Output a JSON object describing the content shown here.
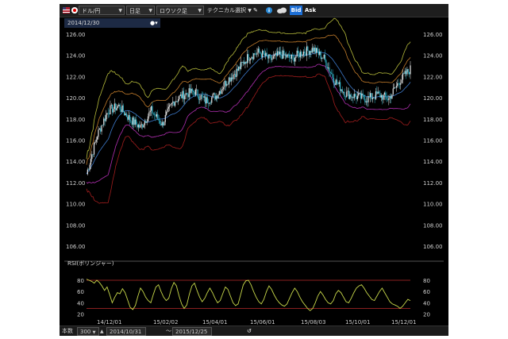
{
  "toolbar": {
    "pair": "ドル/円",
    "period": "日足",
    "chart_kind": "ロウソク足",
    "technical": "テクニカル選択",
    "bid_label": "Bid",
    "ask_label": "Ask"
  },
  "header": {
    "date": "2014/12/30"
  },
  "rsi": {
    "label": "RSI(ボリンジャー)"
  },
  "bottombar": {
    "count_label": "本数",
    "count_value": "300",
    "start_date": "2014/10/31",
    "range_sep": "～",
    "end_date": "2015/12/25"
  },
  "colors": {
    "background": "#000000",
    "rsi_line": "#c8d84a",
    "rsi_band": "#8a1f1f",
    "bid_button": "#1d6fd6"
  },
  "chart_data": [
    {
      "type": "candlestick",
      "yticks": [
        "126.00",
        "124.00",
        "122.00",
        "120.00",
        "118.00",
        "116.00",
        "114.00",
        "112.00",
        "110.00",
        "108.00",
        "106.00"
      ],
      "ylim": [
        106,
        126
      ],
      "xticks": [
        "14/12/01",
        "15/02/02",
        "15/04/01",
        "15/06/01",
        "15/08/03",
        "15/10/01",
        "15/12/01"
      ],
      "price_path": [
        [
          0,
          112.8
        ],
        [
          10,
          116.5
        ],
        [
          20,
          118.8
        ],
        [
          30,
          119.2
        ],
        [
          40,
          118.0
        ],
        [
          50,
          117.2
        ],
        [
          60,
          118.8
        ],
        [
          70,
          117.5
        ],
        [
          80,
          119.6
        ],
        [
          90,
          120.3
        ],
        [
          100,
          120.6
        ],
        [
          110,
          119.7
        ],
        [
          120,
          120.2
        ],
        [
          130,
          121.6
        ],
        [
          140,
          122.6
        ],
        [
          150,
          123.9
        ],
        [
          160,
          124.3
        ],
        [
          170,
          123.6
        ],
        [
          180,
          124.1
        ],
        [
          190,
          123.7
        ],
        [
          200,
          124.3
        ],
        [
          210,
          124.6
        ],
        [
          220,
          123.7
        ],
        [
          230,
          121.6
        ],
        [
          240,
          120.4
        ],
        [
          250,
          120.1
        ],
        [
          260,
          119.9
        ],
        [
          270,
          120.3
        ],
        [
          280,
          119.9
        ],
        [
          290,
          121.6
        ],
        [
          300,
          122.7
        ]
      ]
    },
    {
      "type": "line",
      "title": "RSI(ボリンジャー)",
      "yticks": [
        "80",
        "60",
        "40",
        "20"
      ],
      "ylim": [
        20,
        90
      ],
      "levels": [
        80,
        30
      ],
      "values": [
        82,
        80,
        78,
        75,
        80,
        76,
        70,
        62,
        68,
        55,
        40,
        50,
        58,
        56,
        65,
        58,
        45,
        32,
        28,
        35,
        52,
        66,
        60,
        50,
        44,
        40,
        55,
        68,
        72,
        60,
        50,
        44,
        48,
        65,
        76,
        70,
        52,
        38,
        30,
        36,
        55,
        70,
        75,
        62,
        50,
        42,
        48,
        58,
        66,
        58,
        48,
        40,
        44,
        56,
        68,
        64,
        52,
        40,
        35,
        38,
        55,
        72,
        79,
        80,
        72,
        60,
        50,
        42,
        38,
        46,
        60,
        70,
        64,
        54,
        46,
        40,
        36,
        34,
        38,
        48,
        58,
        66,
        60,
        50,
        42,
        36,
        30,
        26,
        30,
        40,
        52,
        60,
        54,
        46,
        40,
        38,
        44,
        56,
        62,
        58,
        50,
        42,
        40,
        48,
        58,
        66,
        70,
        72,
        66,
        58,
        52,
        46,
        44,
        52,
        60,
        66,
        58,
        50,
        42,
        38,
        36,
        34,
        30,
        34,
        40,
        46,
        44
      ]
    }
  ]
}
